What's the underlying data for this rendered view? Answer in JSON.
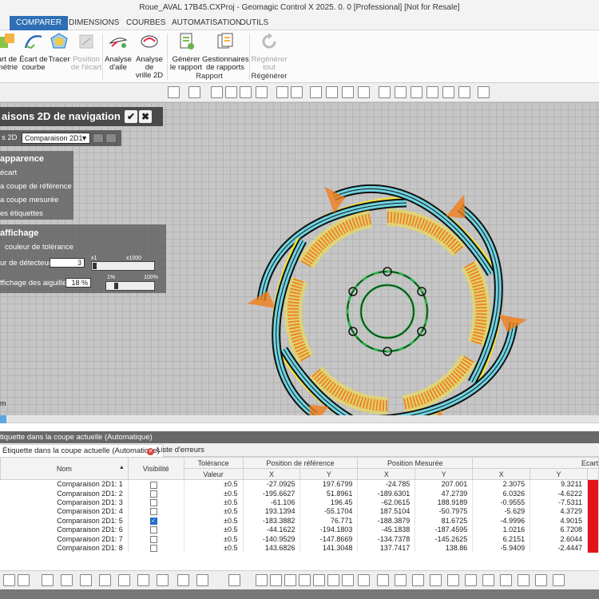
{
  "window": {
    "title": "Roue_AVAL  17B45.CXProj - Geomagic Control X 2025. 0. 0 [Professional] [Not for Resale]"
  },
  "ribbon": {
    "tabs": [
      {
        "label": "COMPARER",
        "active": true
      },
      {
        "label": "DIMENSIONS",
        "active": false
      },
      {
        "label": "COURBES",
        "active": false
      },
      {
        "label": "AUTOMATISATION",
        "active": false
      },
      {
        "label": "OUTILS",
        "active": false
      }
    ],
    "buttons": [
      {
        "line1": "art de",
        "line2": "métrie",
        "icon": "deviation-geometry-icon",
        "disabled": false
      },
      {
        "line1": "Écart de",
        "line2": "courbe",
        "icon": "curve-deviation-icon",
        "disabled": false
      },
      {
        "line1": "Tracer",
        "line2": "",
        "icon": "trace-icon",
        "disabled": false
      },
      {
        "line1": "Position",
        "line2": "de l'écart",
        "icon": "deviation-location-icon",
        "disabled": true
      },
      {
        "line1": "Analyse",
        "line2": "d'aile",
        "icon": "wing-analysis-icon",
        "disabled": false
      },
      {
        "line1": "Analyse de",
        "line2": "vrille 2D",
        "icon": "twist-analysis-icon",
        "disabled": false
      },
      {
        "line1": "Générer",
        "line2": "le rapport",
        "icon": "generate-report-icon",
        "disabled": false
      },
      {
        "line1": "Gestionnaires",
        "line2": "de rapports",
        "icon": "report-manager-icon",
        "disabled": false
      },
      {
        "line1": "Régénérer",
        "line2": "tout",
        "icon": "regenerate-icon",
        "disabled": true
      }
    ],
    "groups": {
      "report": "Rapport",
      "regen": "Régénérer"
    }
  },
  "nav_panel": {
    "title": "aisons 2D de navigation",
    "row_label": "s 2D",
    "combo_value": "Comparaison 2D1"
  },
  "apparence": {
    "title": "apparence",
    "items": [
      "écart",
      "a coupe de référence",
      "a coupe mesurée",
      "es étiquettes"
    ]
  },
  "affichage": {
    "title": "affichage",
    "tolerance_color": "couleur de tolérance",
    "detector_label": "ur de détecteur",
    "detector_value": "3",
    "detector_min": "x1",
    "detector_max": "x1000",
    "needles_label": "ffichage des aiguilles",
    "needles_value": "18 %",
    "needles_min": "1%",
    "needles_max": "100%",
    "needles_fraction": 0.18,
    "detector_fraction": 0.02
  },
  "viewport": {
    "corner_label": "m"
  },
  "colors": {
    "accent": "#2d6eb5",
    "blade_fill": "#6fd3e0",
    "hub": "#2bb34a",
    "deviation": "#f07d1a",
    "tolerance": "#f5e23a"
  },
  "bottom_panel": {
    "header": "tiquette dans la coupe actuelle (Automatique)",
    "tab_active": "Étiquette dans la coupe actuelle (Automatique)",
    "tab_errors": "Liste d'erreurs",
    "columns": {
      "nom": "Nom",
      "visibilite": "Visibilité",
      "tolerance": "Tolérance",
      "valeur": "Valeur",
      "pos_ref": "Position de référence",
      "pos_mes": "Position Mesurée",
      "ecart": "Ecart",
      "x": "X",
      "y": "Y"
    },
    "rows": [
      {
        "name": "Comparaison 2D1: 1",
        "visible": false,
        "tol": "±0.5",
        "rx": "-27.0925",
        "ry": "197.6799",
        "mx": "-24.785",
        "my": "207.001",
        "dx": "2.3075",
        "dy": "9.3211"
      },
      {
        "name": "Comparaison 2D1: 2",
        "visible": false,
        "tol": "±0.5",
        "rx": "-195.6627",
        "ry": "51.8961",
        "mx": "-189.6301",
        "my": "47.2739",
        "dx": "6.0326",
        "dy": "-4.6222"
      },
      {
        "name": "Comparaison 2D1: 3",
        "visible": false,
        "tol": "±0.5",
        "rx": "-61.106",
        "ry": "196.45",
        "mx": "-62.0615",
        "my": "188.9189",
        "dx": "-0.9555",
        "dy": "-7.5311"
      },
      {
        "name": "Comparaison 2D1: 4",
        "visible": false,
        "tol": "±0.5",
        "rx": "193.1394",
        "ry": "-55.1704",
        "mx": "187.5104",
        "my": "-50.7975",
        "dx": "-5.629",
        "dy": "4.3729"
      },
      {
        "name": "Comparaison 2D1: 5",
        "visible": true,
        "tol": "±0.5",
        "rx": "-183.3882",
        "ry": "76.771",
        "mx": "-188.3879",
        "my": "81.6725",
        "dx": "-4.9996",
        "dy": "4.9015"
      },
      {
        "name": "Comparaison 2D1: 6",
        "visible": false,
        "tol": "±0.5",
        "rx": "-44.1622",
        "ry": "-194.1803",
        "mx": "-45.1838",
        "my": "-187.4595",
        "dx": "1.0216",
        "dy": "6.7208"
      },
      {
        "name": "Comparaison 2D1: 7",
        "visible": false,
        "tol": "±0.5",
        "rx": "-140.9529",
        "ry": "-147.8669",
        "mx": "-134.7378",
        "my": "-145.2625",
        "dx": "6.2151",
        "dy": "2.6044"
      },
      {
        "name": "Comparaison 2D1: 8",
        "visible": false,
        "tol": "±0.5",
        "rx": "143.6826",
        "ry": "141.3048",
        "mx": "137.7417",
        "my": "138.86",
        "dx": "-5.9409",
        "dy": "-2.4447"
      }
    ]
  }
}
